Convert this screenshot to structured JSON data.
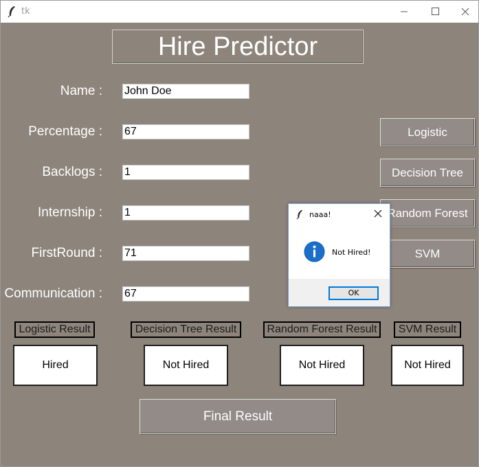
{
  "window": {
    "title": "tk",
    "app_icon": "feather-icon"
  },
  "app": {
    "heading": "Hire Predictor"
  },
  "form": {
    "fields": [
      {
        "label": "Name :",
        "value": "John Doe"
      },
      {
        "label": "Percentage :",
        "value": "67"
      },
      {
        "label": "Backlogs :",
        "value": "1"
      },
      {
        "label": "Internship :",
        "value": "1"
      },
      {
        "label": "FirstRound :",
        "value": "71"
      },
      {
        "label": "Communication :",
        "value": "67"
      }
    ]
  },
  "models": {
    "buttons": [
      "Logistic",
      "Decision Tree",
      "Random Forest",
      "SVM"
    ]
  },
  "results": [
    {
      "label": "Logistic Result",
      "value": "Hired"
    },
    {
      "label": "Decision Tree Result",
      "value": "Not Hired"
    },
    {
      "label": "Random Forest Result",
      "value": "Not Hired"
    },
    {
      "label": "SVM Result",
      "value": "Not Hired"
    }
  ],
  "final_button": "Final Result",
  "dialog": {
    "title": "naaa!",
    "message": "Not Hired!",
    "ok_label": "OK",
    "icon": "info-icon"
  },
  "colors": {
    "background": "#8d857c",
    "button": "#928b87",
    "dialog_accent": "#0078d7",
    "info_icon": "#1c6fc9"
  }
}
